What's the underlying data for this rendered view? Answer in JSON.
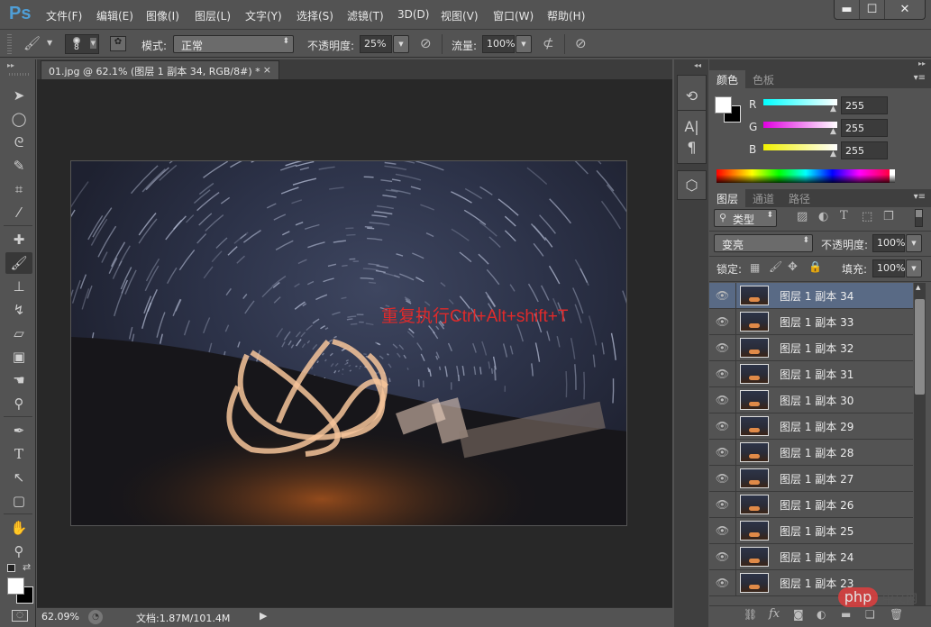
{
  "app": {
    "logo": "Ps"
  },
  "menubar": {
    "items": [
      "文件(F)",
      "编辑(E)",
      "图像(I)",
      "图层(L)",
      "文字(Y)",
      "选择(S)",
      "滤镜(T)",
      "3D(D)",
      "视图(V)",
      "窗口(W)",
      "帮助(H)"
    ],
    "window_controls": {
      "minimize": "▬",
      "maximize": "☐",
      "close": "✕"
    }
  },
  "options": {
    "brush_size": "8",
    "mode_label": "模式:",
    "mode_value": "正常",
    "opacity_label": "不透明度:",
    "opacity_value": "25%",
    "flow_label": "流量:",
    "flow_value": "100%"
  },
  "document": {
    "tab_title": "01.jpg @ 62.1% (图层 1 副本 34, RGB/8#) *",
    "tab_close": "×",
    "overlay_text": "重复执行Ctrl+Alt+shift+T",
    "zoom": "62.09%",
    "doc_info": "文档:1.87M/101.4M"
  },
  "color_panel": {
    "tabs": [
      "颜色",
      "色板"
    ],
    "channels": [
      {
        "label": "R",
        "value": "255"
      },
      {
        "label": "G",
        "value": "255"
      },
      {
        "label": "B",
        "value": "255"
      }
    ],
    "foreground": "#ffffff",
    "background": "#000000"
  },
  "layers_panel": {
    "tabs": [
      "图层",
      "通道",
      "路径"
    ],
    "filter_label": "类型",
    "blend_mode": "变亮",
    "opacity_label": "不透明度:",
    "opacity_value": "100%",
    "lock_label": "锁定:",
    "fill_label": "填充:",
    "fill_value": "100%",
    "layers": [
      {
        "name": "图层 1 副本 34",
        "selected": true
      },
      {
        "name": "图层 1 副本 33"
      },
      {
        "name": "图层 1 副本 32"
      },
      {
        "name": "图层 1 副本 31"
      },
      {
        "name": "图层 1 副本 30"
      },
      {
        "name": "图层 1 副本 29"
      },
      {
        "name": "图层 1 副本 28"
      },
      {
        "name": "图层 1 副本 27"
      },
      {
        "name": "图层 1 副本 26"
      },
      {
        "name": "图层 1 副本 25"
      },
      {
        "name": "图层 1 副本 24"
      },
      {
        "name": "图层 1 副本 23"
      }
    ]
  },
  "watermark": {
    "text": "php",
    "suffix": "中文网"
  }
}
